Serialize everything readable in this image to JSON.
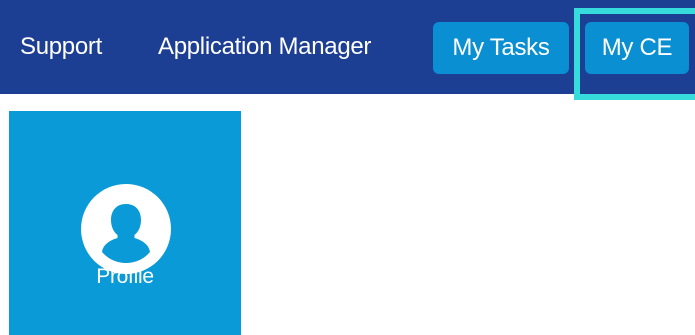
{
  "nav": {
    "items": [
      {
        "label": "Support"
      },
      {
        "label": "Application Manager"
      },
      {
        "label": "My Tasks"
      },
      {
        "label": "My CE"
      }
    ],
    "background_color": "#1d3f93",
    "pill_color": "#0a8fd2",
    "focus_color": "#36dcdc"
  },
  "tiles": [
    {
      "label": "Profile",
      "icon": "user-icon",
      "color": "#0a9ad7"
    }
  ]
}
